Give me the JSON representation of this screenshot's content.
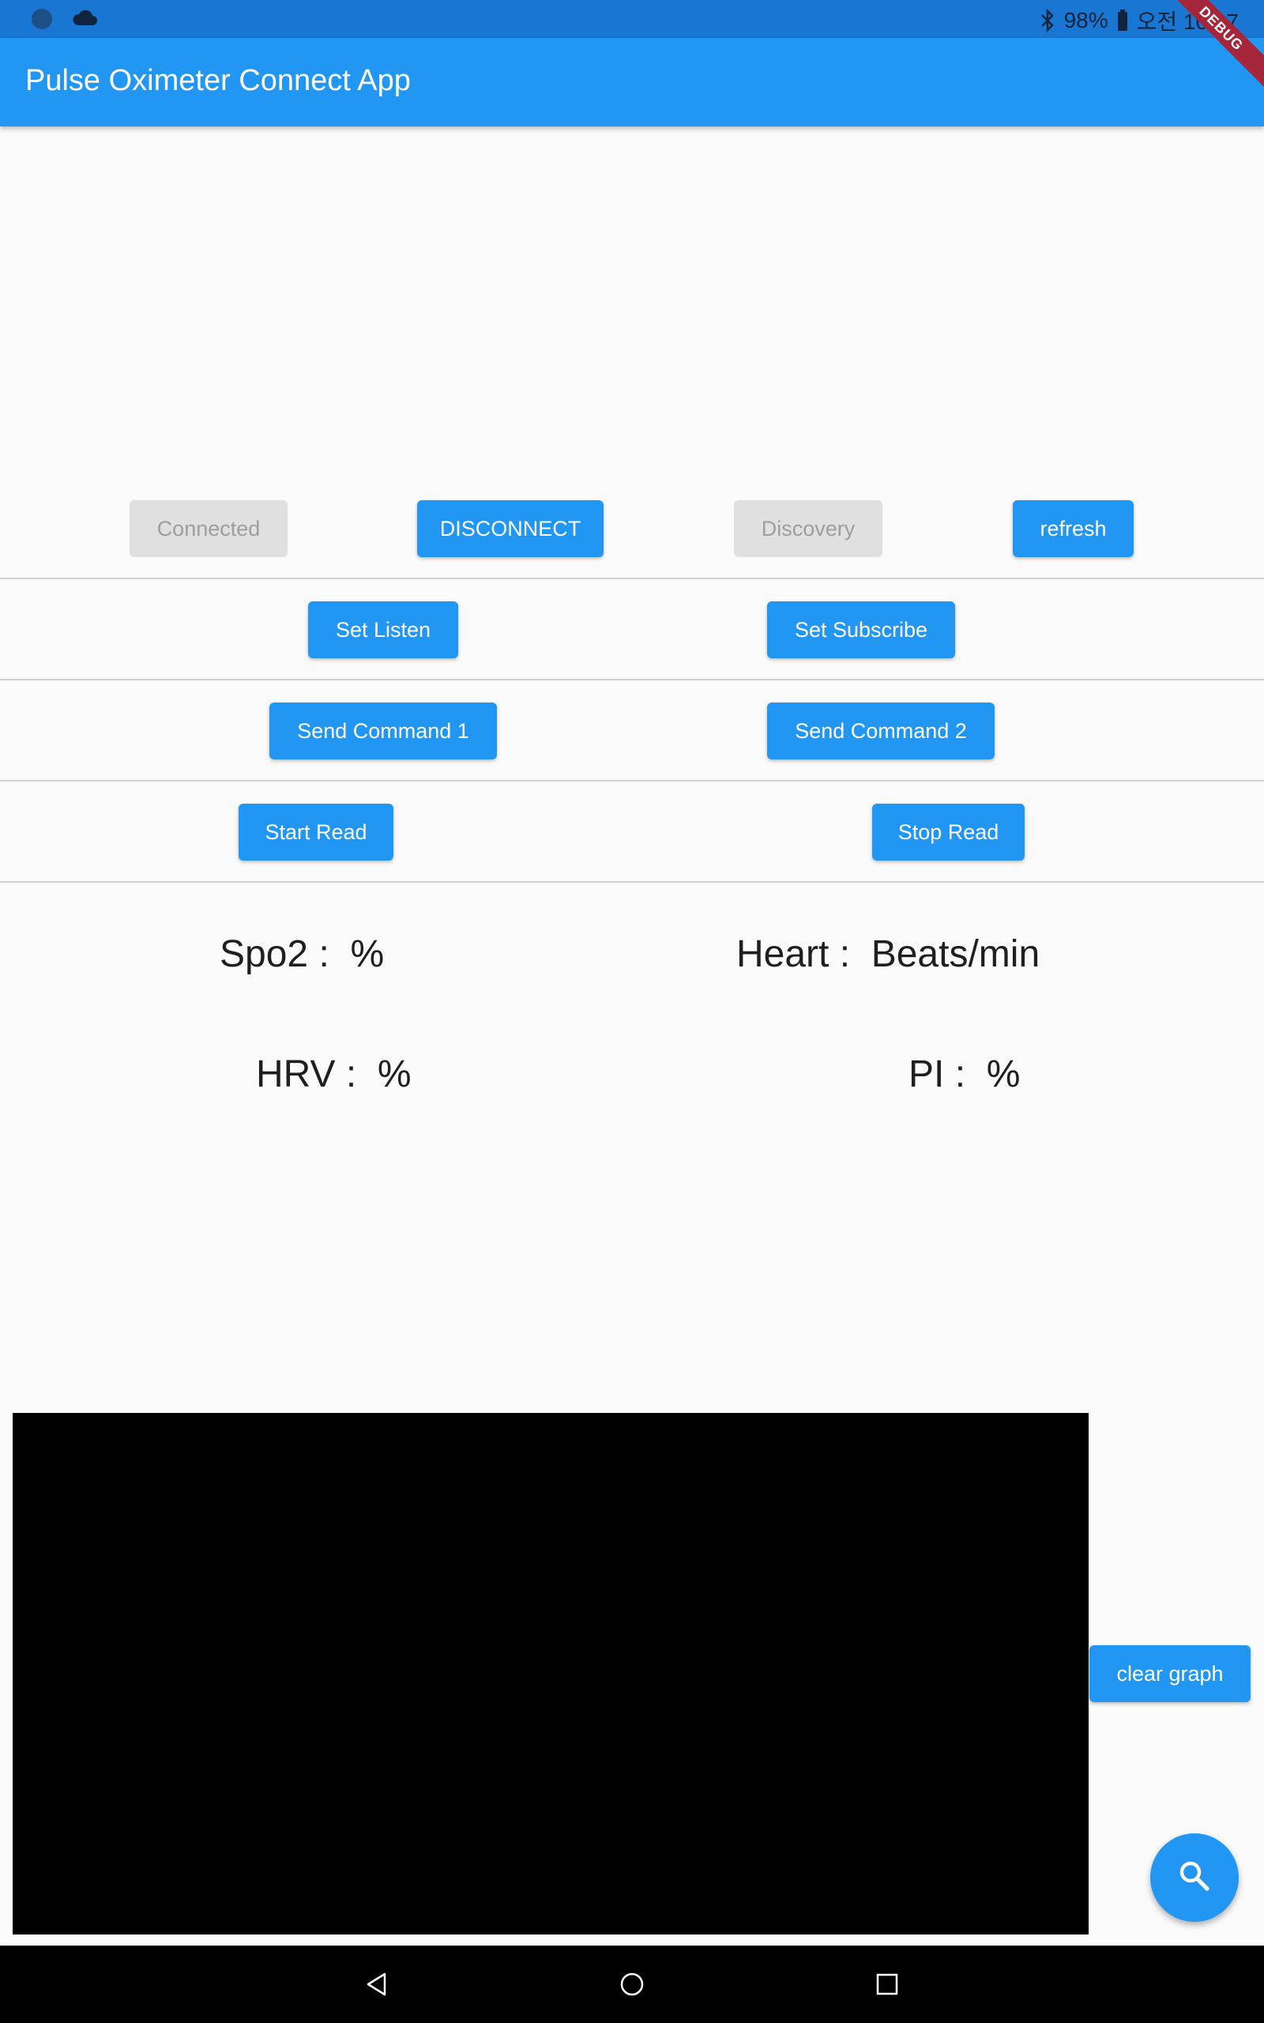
{
  "status_bar": {
    "battery": "98%",
    "time": "오전 10:07"
  },
  "app_bar": {
    "title": "Pulse Oximeter Connect App",
    "debug_label": "DEBUG"
  },
  "controls": {
    "connected": "Connected",
    "disconnect": "DISCONNECT",
    "discovery": "Discovery",
    "refresh": "refresh",
    "set_listen": "Set Listen",
    "set_subscribe": "Set Subscribe",
    "send_command_1": "Send Command 1",
    "send_command_2": "Send Command 2",
    "start_read": "Start Read",
    "stop_read": "Stop Read",
    "clear_graph": "clear graph"
  },
  "readings": {
    "spo2": "Spo2 :  %",
    "heart": "Heart :  Beats/min",
    "hrv": "HRV :  %",
    "pi": "PI :  %"
  },
  "colors": {
    "accent": "#2196f3",
    "status_bar": "#1976d2",
    "disabled": "#e0e0e0"
  }
}
